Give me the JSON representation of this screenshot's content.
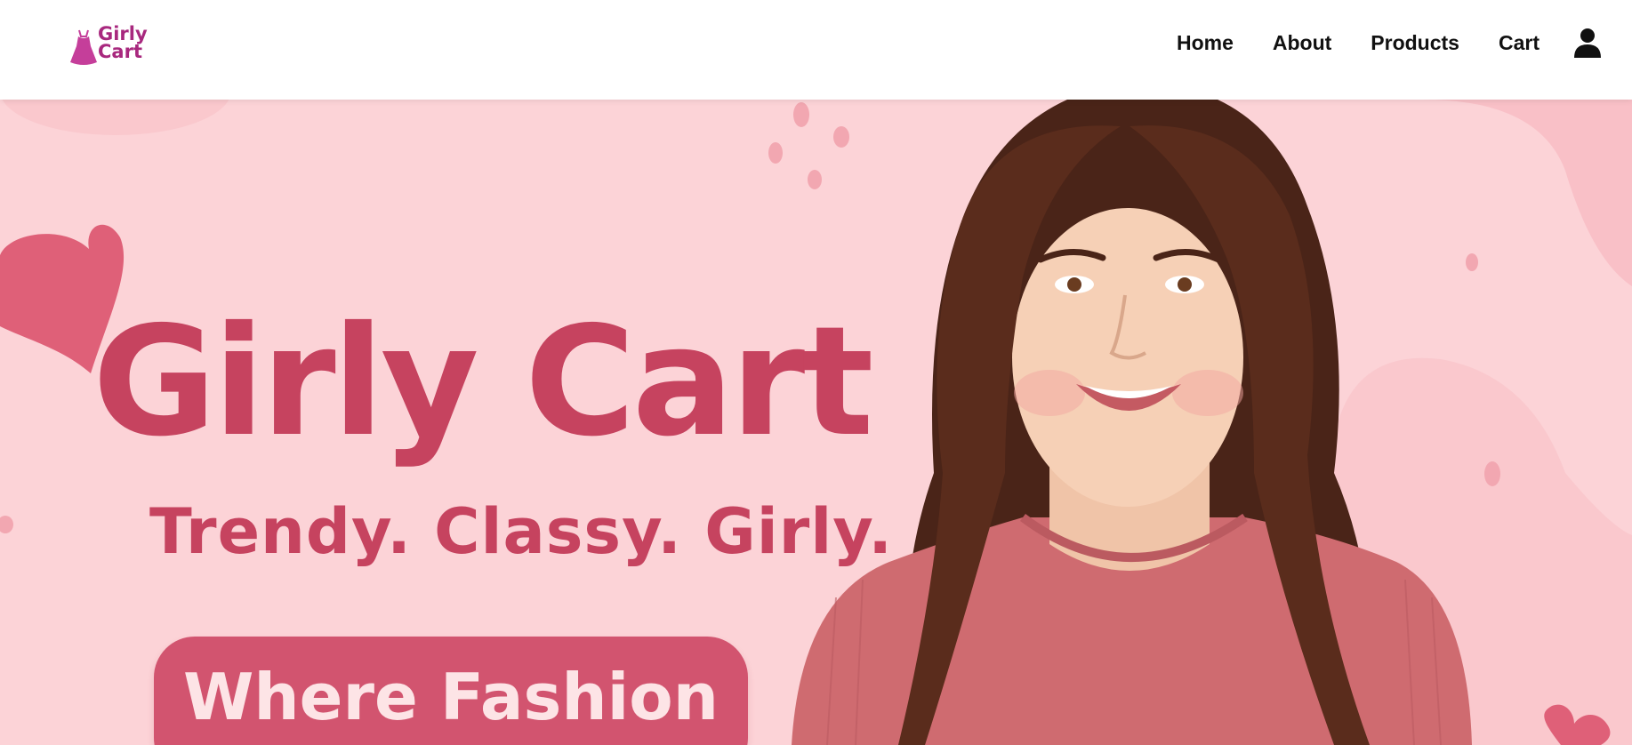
{
  "header": {
    "logo": {
      "line1": "Girly",
      "line2": "Cart",
      "icon": "dress-icon"
    },
    "nav": [
      {
        "label": "Home"
      },
      {
        "label": "About"
      },
      {
        "label": "Products"
      },
      {
        "label": "Cart"
      }
    ],
    "account_icon": "user-icon"
  },
  "hero": {
    "title": "Girly Cart",
    "tagline": "Trendy. Classy. Girly.",
    "badge_text": "Where Fashion",
    "image": "smiling-woman-portrait"
  },
  "colors": {
    "brand_purple": "#a8287e",
    "hero_background": "#fcd3d7",
    "title_pink": "#c6435f",
    "badge_pink": "#d2546f",
    "badge_text": "#fde4e6",
    "heart": "#e0637a"
  }
}
